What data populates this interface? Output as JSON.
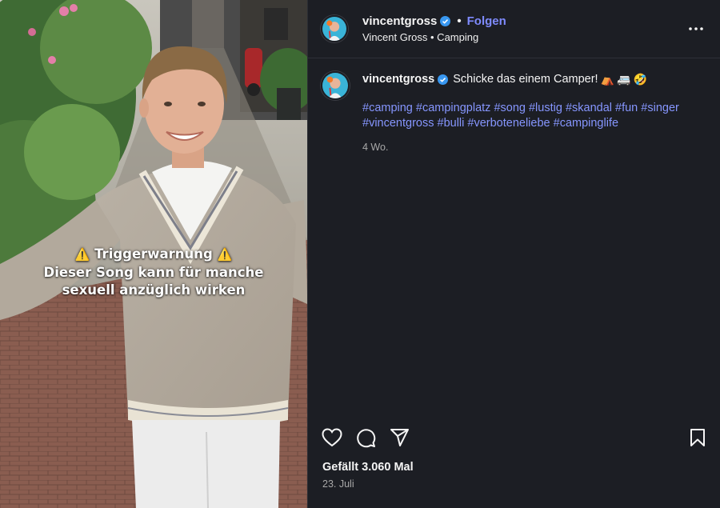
{
  "header": {
    "username": "vincentgross",
    "separator": "•",
    "follow_label": "Folgen",
    "subtitle": "Vincent Gross • Camping"
  },
  "media": {
    "overlay": {
      "line1": "Triggerwarnung",
      "warn_icon": "⚠️",
      "line2": "Dieser Song kann für manche",
      "line3": "sexuell anzüglich wirken"
    }
  },
  "caption": {
    "username": "vincentgross",
    "text": "Schicke das einem Camper!",
    "emojis": [
      "⛺",
      "🚐",
      "🤣"
    ],
    "hashtags": [
      "#camping",
      "#campingplatz",
      "#song",
      "#lustig",
      "#skandal",
      "#fun",
      "#singer",
      "#vincentgross",
      "#bulli",
      "#verboteneliebe",
      "#campinglife"
    ],
    "age": "4 Wo."
  },
  "footer": {
    "likes": "Gefällt 3.060 Mal",
    "date": "23. Juli"
  },
  "colors": {
    "panel_bg": "#1c1e24",
    "link": "#7f8bff",
    "hashtag": "#8696ff",
    "verified": "#3897f0"
  },
  "icons": [
    "more-options-icon",
    "heart-icon",
    "comment-icon",
    "share-icon",
    "bookmark-icon",
    "verified-badge-icon",
    "warning-icon"
  ]
}
